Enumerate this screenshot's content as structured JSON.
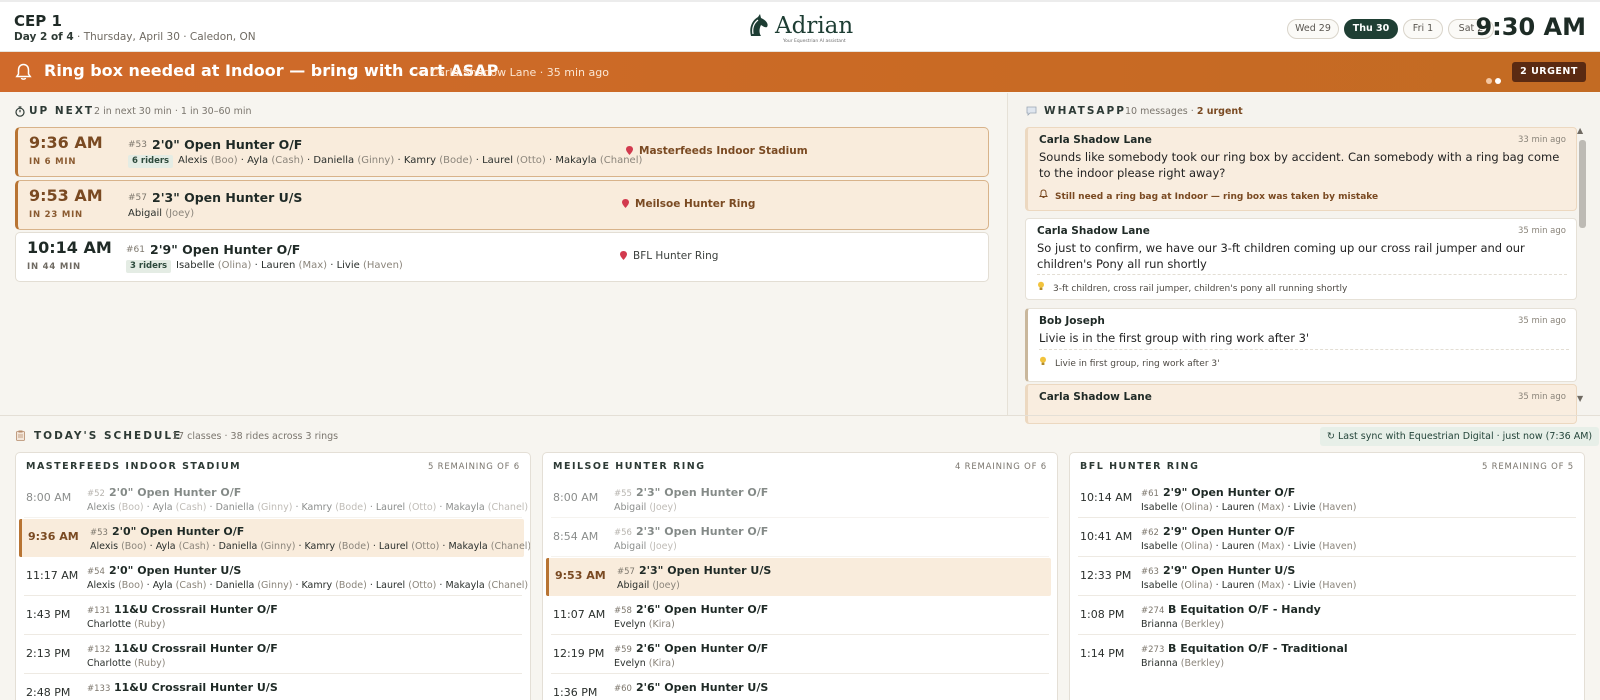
{
  "header": {
    "event_title": "CEP 1",
    "day_of": "Day 2 of 4",
    "date_location": " · Thursday, April 30 · Caledon, ON",
    "logo_word": "Adrian",
    "logo_tagline": "Your Equestrian AI assistant",
    "days": [
      {
        "label": "Wed 29",
        "active": false
      },
      {
        "label": "Thu 30",
        "active": true
      },
      {
        "label": "Fri 1",
        "active": false
      },
      {
        "label": "Sat 2",
        "active": false
      }
    ],
    "clock": "9:30 AM"
  },
  "alert": {
    "icon": "bell-icon",
    "message": "Ring box needed at Indoor — bring with cart ASAP",
    "meta": "— Carla Shadow Lane · 35 min ago",
    "urgent_badge": "2 URGENT"
  },
  "up_next": {
    "heading": "UP NEXT",
    "subtitle": "2 in next 30 min · 1 in 30–60 min",
    "items": [
      {
        "time": "9:36 AM",
        "in": "IN 6 MIN",
        "num": "#53",
        "class": "2'0\" Open Hunter O/F",
        "riders_badge": "6 riders",
        "riders": [
          {
            "name": "Alexis",
            "horse": "(Boo)"
          },
          {
            "name": "Ayla",
            "horse": "(Cash)"
          },
          {
            "name": "Daniella",
            "horse": "(Ginny)"
          },
          {
            "name": "Kamry",
            "horse": "(Bode)"
          },
          {
            "name": "Laurel",
            "horse": "(Otto)"
          },
          {
            "name": "Makayla",
            "horse": "(Chanel)"
          }
        ],
        "ring": "Masterfeeds Indoor Stadium",
        "highlight": true
      },
      {
        "time": "9:53 AM",
        "in": "IN 23 MIN",
        "num": "#57",
        "class": "2'3\" Open Hunter U/S",
        "riders_badge": "",
        "riders": [
          {
            "name": "Abigail",
            "horse": "(Joey)"
          }
        ],
        "ring": "Meilsoe Hunter Ring",
        "highlight": true
      },
      {
        "time": "10:14 AM",
        "in": "IN 44 MIN",
        "num": "#61",
        "class": "2'9\" Open Hunter O/F",
        "riders_badge": "3 riders",
        "riders": [
          {
            "name": "Isabelle",
            "horse": "(Olina)"
          },
          {
            "name": "Lauren",
            "horse": "(Max)"
          },
          {
            "name": "Livie",
            "horse": "(Haven)"
          }
        ],
        "ring": "BFL Hunter Ring",
        "highlight": false
      }
    ]
  },
  "whatsapp": {
    "heading": "WHATSAPP",
    "count": "10 messages · ",
    "urgent": "2 urgent",
    "messages": [
      {
        "from": "Carla Shadow Lane",
        "time": "33 min ago",
        "text": "Sounds like somebody took our ring box by accident. Can somebody with a ring bag come to the indoor please right away?",
        "note_icon": "bell-icon",
        "note": "Still need a ring bag at Indoor — ring box was taken by mistake",
        "urgent": true
      },
      {
        "from": "Carla Shadow Lane",
        "time": "35 min ago",
        "text": "So just to confirm, we have our 3-ft children coming up our cross rail jumper and our children's Pony all run shortly",
        "note_icon": "lightbulb-icon",
        "note": "3-ft children, cross rail jumper, children's pony all running shortly",
        "urgent": false
      },
      {
        "from": "Bob Joseph",
        "time": "35 min ago",
        "text": "Livie is in the first group with ring work after 3'",
        "note_icon": "lightbulb-icon",
        "note": "Livie in first group, ring work after 3'",
        "urgent": false
      },
      {
        "from": "Carla Shadow Lane",
        "time": "35 min ago",
        "text": "",
        "note_icon": "",
        "note": "",
        "urgent": true
      }
    ]
  },
  "schedule": {
    "heading": "TODAY'S SCHEDULE",
    "subtitle": "17 classes · 38 rides across 3 rings",
    "sync": "Last sync with Equestrian Digital · just now (7:36 AM)",
    "rings": [
      {
        "title": "MASTERFEEDS INDOOR STADIUM",
        "remaining": "5 REMAINING OF 6",
        "rows": [
          {
            "time": "8:00 AM",
            "num": "#52",
            "class": "2'0\" Open Hunter O/F",
            "status": "past",
            "riders": [
              {
                "name": "Alexis",
                "horse": "(Boo)"
              },
              {
                "name": "Ayla",
                "horse": "(Cash)"
              },
              {
                "name": "Daniella",
                "horse": "(Ginny)"
              },
              {
                "name": "Kamry",
                "horse": "(Bode)"
              },
              {
                "name": "Laurel",
                "horse": "(Otto)"
              },
              {
                "name": "Makayla",
                "horse": "(Chanel)"
              }
            ]
          },
          {
            "time": "9:36 AM",
            "num": "#53",
            "class": "2'0\" Open Hunter O/F",
            "status": "current",
            "riders": [
              {
                "name": "Alexis",
                "horse": "(Boo)"
              },
              {
                "name": "Ayla",
                "horse": "(Cash)"
              },
              {
                "name": "Daniella",
                "horse": "(Ginny)"
              },
              {
                "name": "Kamry",
                "horse": "(Bode)"
              },
              {
                "name": "Laurel",
                "horse": "(Otto)"
              },
              {
                "name": "Makayla",
                "horse": "(Chanel)"
              }
            ]
          },
          {
            "time": "11:17 AM",
            "num": "#54",
            "class": "2'0\" Open Hunter U/S",
            "status": "upcoming",
            "riders": [
              {
                "name": "Alexis",
                "horse": "(Boo)"
              },
              {
                "name": "Ayla",
                "horse": "(Cash)"
              },
              {
                "name": "Daniella",
                "horse": "(Ginny)"
              },
              {
                "name": "Kamry",
                "horse": "(Bode)"
              },
              {
                "name": "Laurel",
                "horse": "(Otto)"
              },
              {
                "name": "Makayla",
                "horse": "(Chanel)"
              }
            ]
          },
          {
            "time": "1:43 PM",
            "num": "#131",
            "class": "11&U Crossrail Hunter O/F",
            "status": "upcoming",
            "riders": [
              {
                "name": "Charlotte",
                "horse": "(Ruby)"
              }
            ]
          },
          {
            "time": "2:13 PM",
            "num": "#132",
            "class": "11&U Crossrail Hunter O/F",
            "status": "upcoming",
            "riders": [
              {
                "name": "Charlotte",
                "horse": "(Ruby)"
              }
            ]
          },
          {
            "time": "2:48 PM",
            "num": "#133",
            "class": "11&U Crossrail Hunter U/S",
            "status": "upcoming",
            "riders": []
          }
        ]
      },
      {
        "title": "MEILSOE HUNTER RING",
        "remaining": "4 REMAINING OF 6",
        "rows": [
          {
            "time": "8:00 AM",
            "num": "#55",
            "class": "2'3\" Open Hunter O/F",
            "status": "past",
            "riders": [
              {
                "name": "Abigail",
                "horse": "(Joey)"
              }
            ]
          },
          {
            "time": "8:54 AM",
            "num": "#56",
            "class": "2'3\" Open Hunter O/F",
            "status": "past",
            "riders": [
              {
                "name": "Abigail",
                "horse": "(Joey)"
              }
            ]
          },
          {
            "time": "9:53 AM",
            "num": "#57",
            "class": "2'3\" Open Hunter U/S",
            "status": "current",
            "riders": [
              {
                "name": "Abigail",
                "horse": "(Joey)"
              }
            ]
          },
          {
            "time": "11:07 AM",
            "num": "#58",
            "class": "2'6\" Open Hunter O/F",
            "status": "upcoming",
            "riders": [
              {
                "name": "Evelyn",
                "horse": "(Kira)"
              }
            ]
          },
          {
            "time": "12:19 PM",
            "num": "#59",
            "class": "2'6\" Open Hunter O/F",
            "status": "upcoming",
            "riders": [
              {
                "name": "Evelyn",
                "horse": "(Kira)"
              }
            ]
          },
          {
            "time": "1:36 PM",
            "num": "#60",
            "class": "2'6\" Open Hunter U/S",
            "status": "upcoming",
            "riders": []
          }
        ]
      },
      {
        "title": "BFL HUNTER RING",
        "remaining": "5 REMAINING OF 5",
        "rows": [
          {
            "time": "10:14 AM",
            "num": "#61",
            "class": "2'9\" Open Hunter O/F",
            "status": "upcoming",
            "riders": [
              {
                "name": "Isabelle",
                "horse": "(Olina)"
              },
              {
                "name": "Lauren",
                "horse": "(Max)"
              },
              {
                "name": "Livie",
                "horse": "(Haven)"
              }
            ]
          },
          {
            "time": "10:41 AM",
            "num": "#62",
            "class": "2'9\" Open Hunter O/F",
            "status": "upcoming",
            "riders": [
              {
                "name": "Isabelle",
                "horse": "(Olina)"
              },
              {
                "name": "Lauren",
                "horse": "(Max)"
              },
              {
                "name": "Livie",
                "horse": "(Haven)"
              }
            ]
          },
          {
            "time": "12:33 PM",
            "num": "#63",
            "class": "2'9\" Open Hunter U/S",
            "status": "upcoming",
            "riders": [
              {
                "name": "Isabelle",
                "horse": "(Olina)"
              },
              {
                "name": "Lauren",
                "horse": "(Max)"
              },
              {
                "name": "Livie",
                "horse": "(Haven)"
              }
            ]
          },
          {
            "time": "1:08 PM",
            "num": "#274",
            "class": "B Equitation O/F - Handy",
            "status": "upcoming",
            "riders": [
              {
                "name": "Brianna",
                "horse": "(Berkley)"
              }
            ]
          },
          {
            "time": "1:14 PM",
            "num": "#273",
            "class": "B Equitation O/F - Traditional",
            "status": "upcoming",
            "riders": [
              {
                "name": "Brianna",
                "horse": "(Berkley)"
              }
            ]
          }
        ]
      }
    ]
  },
  "colors": {
    "accent_green": "#1f3f34",
    "alert_orange": "#c96a24",
    "highlight_bg": "#f9ecdc",
    "highlight_border": "#b87433"
  }
}
